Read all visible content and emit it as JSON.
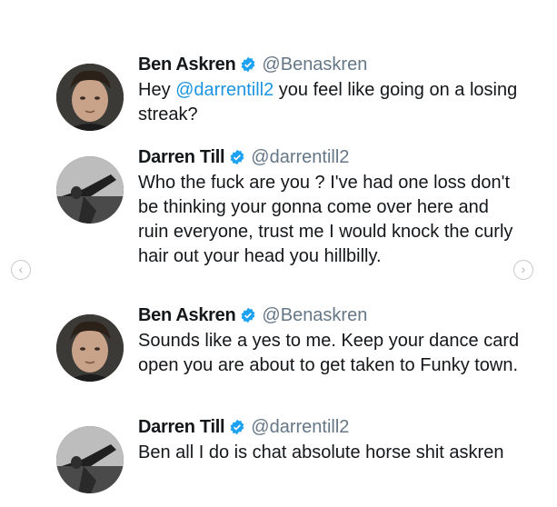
{
  "tweets": [
    {
      "name": "Ben Askren",
      "handle": "@Benaskren",
      "avatar": "ben-askren-avatar",
      "text_parts": [
        "Hey ",
        "@darrentill2",
        " you feel like going on a losing streak?"
      ]
    },
    {
      "name": "Darren Till",
      "handle": "@darrentill2",
      "avatar": "darren-till-avatar",
      "text": "Who the fuck are you ? I've had one loss don't be thinking your gonna come over here and ruin everyone, trust me I would knock the curly hair out your head you hillbilly."
    },
    {
      "name": "Ben Askren",
      "handle": "@Benaskren",
      "avatar": "ben-askren-avatar",
      "text": "Sounds like a yes to me.  Keep your dance card open you are about to get taken to Funky town."
    },
    {
      "name": "Darren Till",
      "handle": "@darrentill2",
      "avatar": "darren-till-avatar",
      "text": "Ben all I do is chat absolute horse shit askren"
    }
  ],
  "nav": {
    "prev_icon": "‹",
    "next_icon": "›"
  },
  "colors": {
    "verified": "#1da1f2",
    "mention": "#1b95e0",
    "handle": "#657786"
  }
}
